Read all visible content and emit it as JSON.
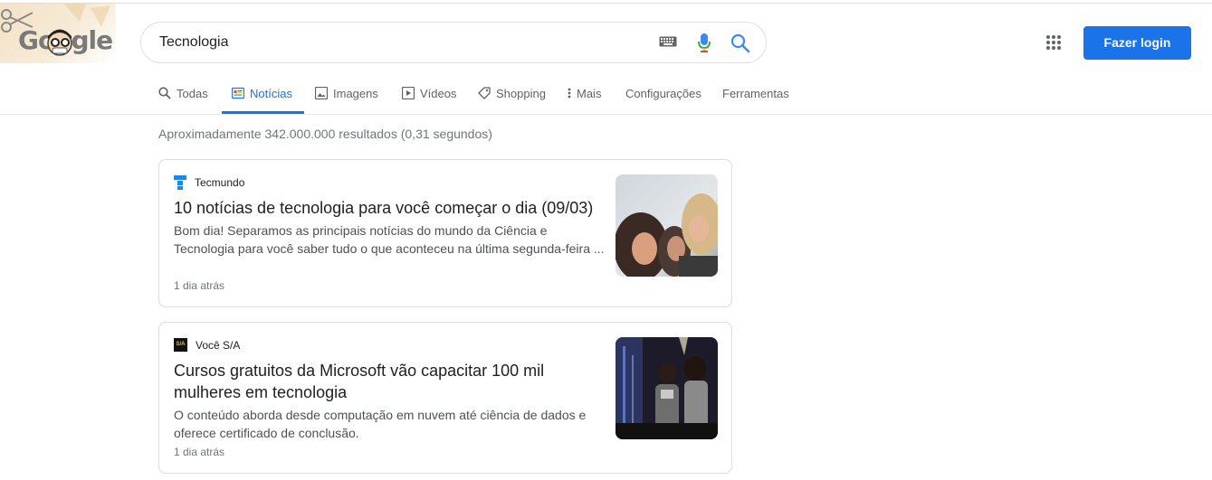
{
  "header": {
    "logo_text": "Google",
    "search_query": "Tecnologia",
    "login_label": "Fazer login",
    "icons": [
      "keyboard-icon",
      "microphone-icon",
      "search-icon",
      "apps-grid-icon"
    ]
  },
  "tabs": [
    {
      "label": "Todas",
      "icon": "search-icon"
    },
    {
      "label": "Notícias",
      "icon": "news-icon",
      "active": true
    },
    {
      "label": "Imagens",
      "icon": "image-icon"
    },
    {
      "label": "Vídeos",
      "icon": "video-icon"
    },
    {
      "label": "Shopping",
      "icon": "tag-icon"
    },
    {
      "label": "Mais",
      "icon": "more-vert-icon"
    },
    {
      "label": "Configurações"
    },
    {
      "label": "Ferramentas"
    }
  ],
  "result_stats": "Aproximadamente 342.000.000 resultados (0,31 segundos)",
  "results": [
    {
      "source": "Tecmundo",
      "title": "10 notícias de tecnologia para você começar o dia (09/03)",
      "snippet": "Bom dia! Separamos as principais notícias do mundo da Ciência e Tecnologia para você saber tudo o que aconteceu na última segunda-feira ...",
      "time": "1 dia atrás"
    },
    {
      "source": "Você S/A",
      "source_logo_text": "S/A",
      "title": "Cursos gratuitos da Microsoft vão capacitar 100 mil mulheres em tecnologia",
      "snippet": "O conteúdo aborda desde computação em nuvem até ciência de dados e oferece certificado de conclusão.",
      "time": "1 dia atrás"
    }
  ],
  "colors": {
    "accent": "#1a73e8",
    "text": "#202124",
    "muted": "#70757a"
  }
}
